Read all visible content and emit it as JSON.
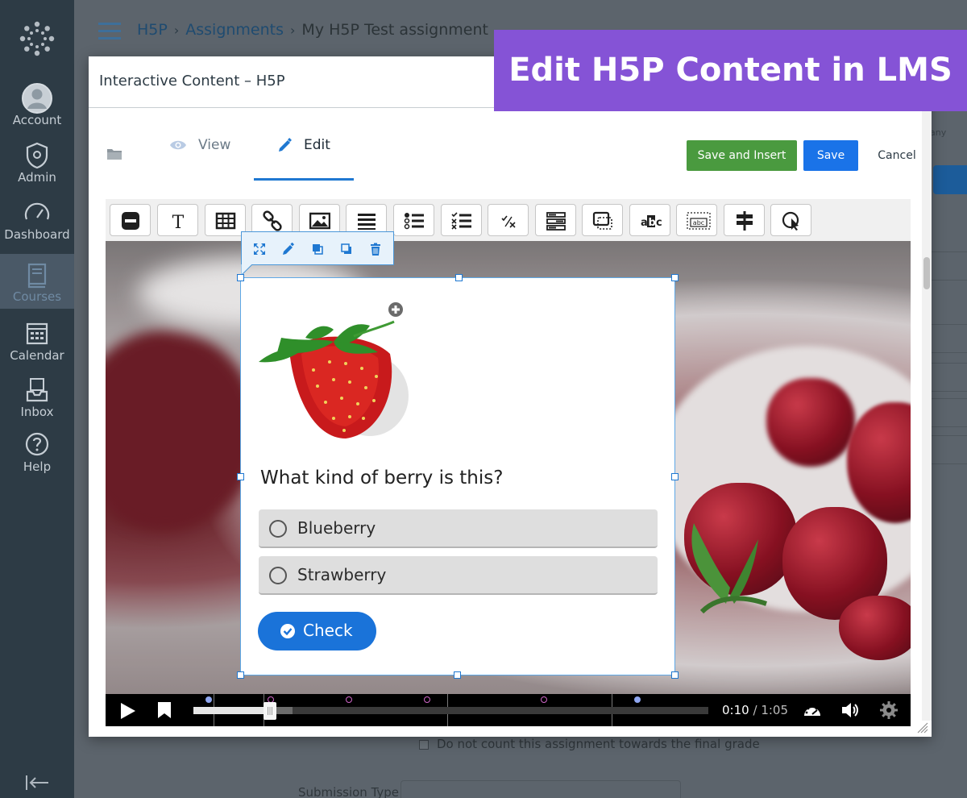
{
  "nav": {
    "items": [
      {
        "label": "Account",
        "icon": "account-icon"
      },
      {
        "label": "Admin",
        "icon": "shield-icon"
      },
      {
        "label": "Dashboard",
        "icon": "dashboard-icon"
      },
      {
        "label": "Courses",
        "icon": "book-icon"
      },
      {
        "label": "Calendar",
        "icon": "calendar-icon"
      },
      {
        "label": "Inbox",
        "icon": "inbox-icon"
      },
      {
        "label": "Help",
        "icon": "help-icon"
      }
    ],
    "active": "Courses"
  },
  "breadcrumb": {
    "items": [
      "H5P",
      "Assignments",
      "My H5P Test assignment"
    ],
    "separator": "›"
  },
  "page": {
    "grade_option": "Do not count this assignment towards the final grade",
    "submission_type_label": "Submission Type",
    "right_fragment": "any"
  },
  "modal": {
    "title": "Interactive Content – H5P"
  },
  "editor": {
    "tabs": {
      "view": "View",
      "edit": "Edit"
    },
    "active_tab": "Edit",
    "buttons": {
      "save_insert": "Save and Insert",
      "save": "Save",
      "cancel": "Cancel"
    },
    "toolbar_tools": [
      "label",
      "text",
      "table",
      "link",
      "image",
      "statements",
      "single-choice-set",
      "multiple-choice",
      "true-false",
      "drag-and-drop",
      "summary",
      "mark-the-words",
      "fill-in-the-blanks",
      "navigation-hotspot",
      "crossroads"
    ]
  },
  "question": {
    "text": "What kind of berry is this?",
    "answers": [
      "Blueberry",
      "Strawberry"
    ],
    "check_label": "Check"
  },
  "player": {
    "current": "0:10",
    "separator": "/",
    "total": "1:05",
    "progress": 0.154
  },
  "banner": {
    "text": "Edit H5P Content in LMS"
  },
  "colors": {
    "nav_bg": "#2d3b45",
    "save_insert": "#4a9a3f",
    "save": "#1a73e8",
    "banner": "#8553d6",
    "check": "#1a73d9"
  }
}
